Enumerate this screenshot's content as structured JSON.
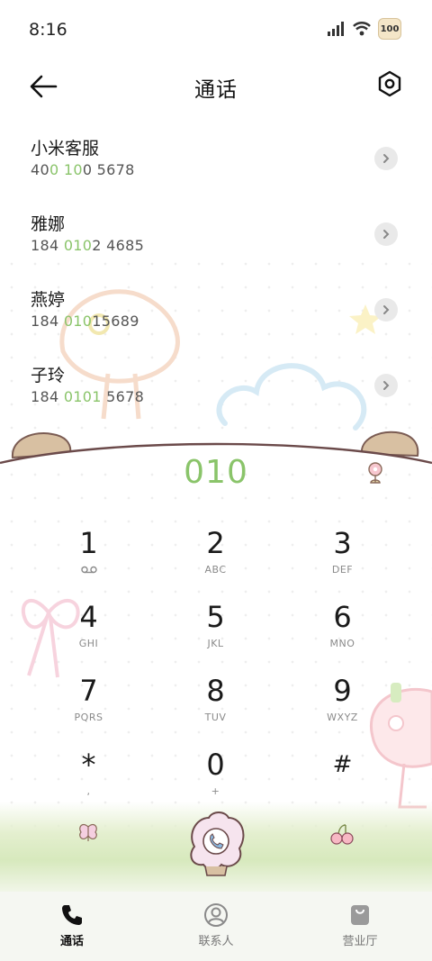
{
  "status": {
    "time": "8:16",
    "battery": "100"
  },
  "header": {
    "title": "通话"
  },
  "contacts": [
    {
      "name": "小米客服",
      "number_parts": [
        "40",
        "0",
        " ",
        "10",
        "0 5678"
      ]
    },
    {
      "name": "雅娜",
      "number_parts": [
        "184 ",
        "010",
        "2 4685"
      ]
    },
    {
      "name": "燕婷",
      "number_parts": [
        "184 ",
        "010",
        "15689"
      ]
    },
    {
      "name": "子玲",
      "number_parts": [
        "184 ",
        "0101",
        " 5678"
      ]
    }
  ],
  "dialer": {
    "entered": "010",
    "keys": [
      [
        {
          "digit": "1",
          "sub": ""
        },
        {
          "digit": "2",
          "sub": "ABC"
        },
        {
          "digit": "3",
          "sub": "DEF"
        }
      ],
      [
        {
          "digit": "4",
          "sub": "GHI"
        },
        {
          "digit": "5",
          "sub": "JKL"
        },
        {
          "digit": "6",
          "sub": "MNO"
        }
      ],
      [
        {
          "digit": "7",
          "sub": "PQRS"
        },
        {
          "digit": "8",
          "sub": "TUV"
        },
        {
          "digit": "9",
          "sub": "WXYZ"
        }
      ],
      [
        {
          "digit": "*",
          "sub": ","
        },
        {
          "digit": "0",
          "sub": "+"
        },
        {
          "digit": "#",
          "sub": ""
        }
      ]
    ]
  },
  "bottom_nav": [
    {
      "label": "通话",
      "icon": "phone-icon",
      "active": true
    },
    {
      "label": "联系人",
      "icon": "person-icon",
      "active": false
    },
    {
      "label": "营业厅",
      "icon": "bag-icon",
      "active": false
    }
  ],
  "colors": {
    "accent_green": "#8ac46a",
    "chevron_bg": "#e9e9e9",
    "nav_bg": "#f5f7f2"
  }
}
